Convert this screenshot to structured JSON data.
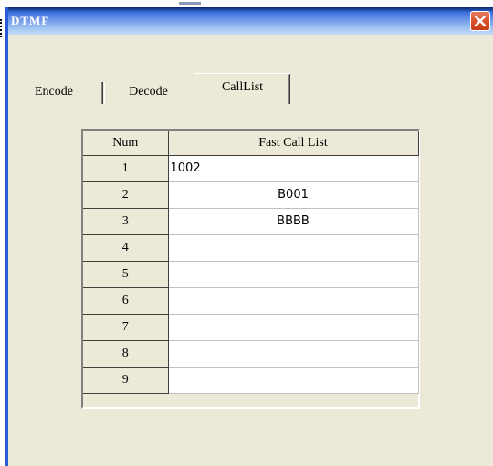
{
  "window": {
    "title": "DTMF",
    "close_icon": "close-icon"
  },
  "tabs": [
    {
      "label": "Encode",
      "selected": false
    },
    {
      "label": "Decode",
      "selected": false
    },
    {
      "label": "CallList",
      "selected": true
    }
  ],
  "table": {
    "headers": [
      "Num",
      "Fast Call List"
    ],
    "rows": [
      {
        "num": "1",
        "value": "1002"
      },
      {
        "num": "2",
        "value": "B001"
      },
      {
        "num": "3",
        "value": "BBBB"
      },
      {
        "num": "4",
        "value": ""
      },
      {
        "num": "5",
        "value": ""
      },
      {
        "num": "6",
        "value": ""
      },
      {
        "num": "7",
        "value": ""
      },
      {
        "num": "8",
        "value": ""
      },
      {
        "num": "9",
        "value": ""
      }
    ]
  },
  "colors": {
    "titlebar": "#3a6fd8",
    "dialog_bg": "#ece9d8",
    "close_red": "#d9532e"
  }
}
